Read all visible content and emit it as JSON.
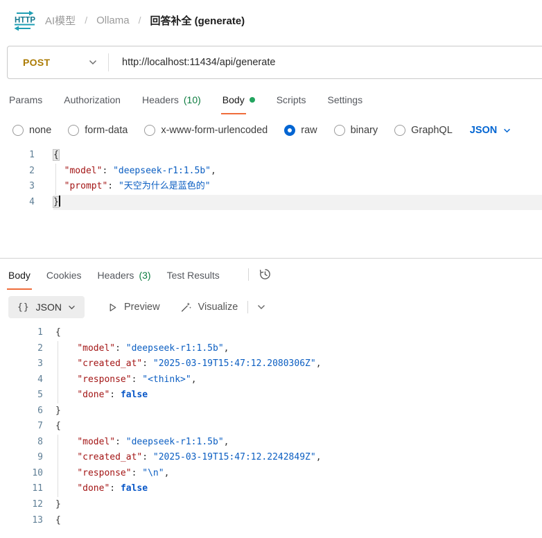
{
  "breadcrumb": {
    "items": [
      "AI模型",
      "Ollama"
    ],
    "separator": "/",
    "current": "回答补全 (generate)"
  },
  "request_bar": {
    "method": "POST",
    "url": "http://localhost:11434/api/generate"
  },
  "request_tabs": [
    {
      "label": "Params"
    },
    {
      "label": "Authorization"
    },
    {
      "label": "Headers",
      "count": "(10)"
    },
    {
      "label": "Body",
      "active": true,
      "dot": true
    },
    {
      "label": "Scripts"
    },
    {
      "label": "Settings"
    }
  ],
  "body_types": [
    {
      "label": "none"
    },
    {
      "label": "form-data"
    },
    {
      "label": "x-www-form-urlencoded"
    },
    {
      "label": "raw",
      "selected": true
    },
    {
      "label": "binary"
    },
    {
      "label": "GraphQL"
    }
  ],
  "body_format": "JSON",
  "request_editor": {
    "lines": [
      {
        "n": 1,
        "g": false,
        "cur": false,
        "toks": [
          [
            "ph",
            "{"
          ]
        ]
      },
      {
        "n": 2,
        "g": true,
        "cur": false,
        "toks": [
          [
            "w",
            "  "
          ],
          [
            "k",
            "\"model\""
          ],
          [
            "p",
            ": "
          ],
          [
            "s",
            "\"deepseek-r1:1.5b\""
          ],
          [
            "p",
            ","
          ]
        ]
      },
      {
        "n": 3,
        "g": true,
        "cur": false,
        "toks": [
          [
            "w",
            "  "
          ],
          [
            "k",
            "\"prompt\""
          ],
          [
            "p",
            ": "
          ],
          [
            "s",
            "\"天空为什么是蓝色的\""
          ]
        ]
      },
      {
        "n": 4,
        "g": false,
        "cur": true,
        "toks": [
          [
            "ph",
            "}"
          ],
          [
            "cursor",
            ""
          ]
        ]
      }
    ]
  },
  "response_tabs": [
    {
      "label": "Body",
      "active": true
    },
    {
      "label": "Cookies"
    },
    {
      "label": "Headers",
      "count": "(3)"
    },
    {
      "label": "Test Results"
    }
  ],
  "response_toolbar": {
    "braces": "{}",
    "format": "JSON",
    "preview": "Preview",
    "visualize": "Visualize"
  },
  "response_editor": {
    "lines": [
      {
        "n": 1,
        "g": false,
        "toks": [
          [
            "p",
            "{"
          ]
        ]
      },
      {
        "n": 2,
        "g": true,
        "toks": [
          [
            "w",
            "    "
          ],
          [
            "k",
            "\"model\""
          ],
          [
            "p",
            ": "
          ],
          [
            "s",
            "\"deepseek-r1:1.5b\""
          ],
          [
            "p",
            ","
          ]
        ]
      },
      {
        "n": 3,
        "g": true,
        "toks": [
          [
            "w",
            "    "
          ],
          [
            "k",
            "\"created_at\""
          ],
          [
            "p",
            ": "
          ],
          [
            "s",
            "\"2025-03-19T15:47:12.2080306Z\""
          ],
          [
            "p",
            ","
          ]
        ]
      },
      {
        "n": 4,
        "g": true,
        "toks": [
          [
            "w",
            "    "
          ],
          [
            "k",
            "\"response\""
          ],
          [
            "p",
            ": "
          ],
          [
            "s",
            "\"<think>\""
          ],
          [
            "p",
            ","
          ]
        ]
      },
      {
        "n": 5,
        "g": true,
        "toks": [
          [
            "w",
            "    "
          ],
          [
            "k",
            "\"done\""
          ],
          [
            "p",
            ": "
          ],
          [
            "b",
            "false"
          ]
        ]
      },
      {
        "n": 6,
        "g": false,
        "toks": [
          [
            "p",
            "}"
          ]
        ]
      },
      {
        "n": 7,
        "g": false,
        "toks": [
          [
            "p",
            "{"
          ]
        ]
      },
      {
        "n": 8,
        "g": true,
        "toks": [
          [
            "w",
            "    "
          ],
          [
            "k",
            "\"model\""
          ],
          [
            "p",
            ": "
          ],
          [
            "s",
            "\"deepseek-r1:1.5b\""
          ],
          [
            "p",
            ","
          ]
        ]
      },
      {
        "n": 9,
        "g": true,
        "toks": [
          [
            "w",
            "    "
          ],
          [
            "k",
            "\"created_at\""
          ],
          [
            "p",
            ": "
          ],
          [
            "s",
            "\"2025-03-19T15:47:12.2242849Z\""
          ],
          [
            "p",
            ","
          ]
        ]
      },
      {
        "n": 10,
        "g": true,
        "toks": [
          [
            "w",
            "    "
          ],
          [
            "k",
            "\"response\""
          ],
          [
            "p",
            ": "
          ],
          [
            "s",
            "\"\\n\""
          ],
          [
            "p",
            ","
          ]
        ]
      },
      {
        "n": 11,
        "g": true,
        "toks": [
          [
            "w",
            "    "
          ],
          [
            "k",
            "\"done\""
          ],
          [
            "p",
            ": "
          ],
          [
            "b",
            "false"
          ]
        ]
      },
      {
        "n": 12,
        "g": false,
        "toks": [
          [
            "p",
            "}"
          ]
        ]
      },
      {
        "n": 13,
        "g": false,
        "toks": [
          [
            "p",
            "{"
          ]
        ]
      }
    ]
  },
  "colors": {
    "accent_orange": "#ef6c3a",
    "post_method": "#ab7b04",
    "link_blue": "#0265d2",
    "count_green": "#0c7c3f",
    "dot_green": "#23a45f",
    "icon_teal": "#1f9fb4",
    "code_key": "#a31515",
    "code_string": "#0b5ec2",
    "code_bool": "#0a58c8"
  }
}
